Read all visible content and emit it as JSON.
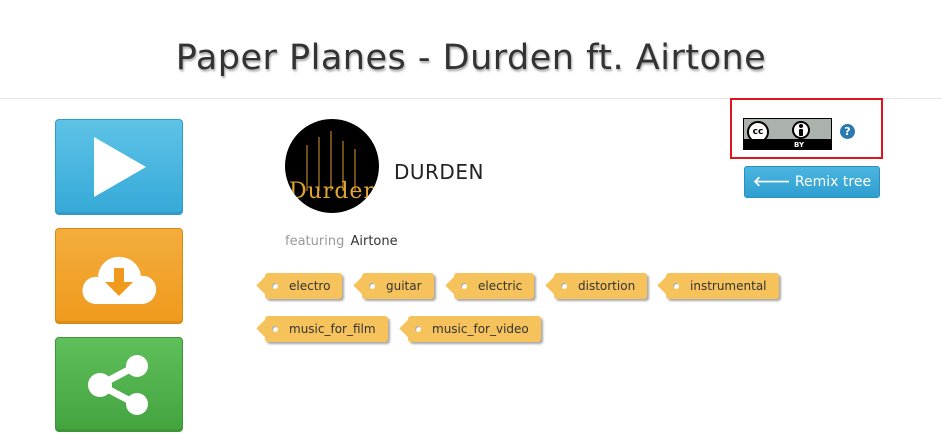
{
  "header": {
    "title": "Paper Planes - Durden ft. Airtone"
  },
  "actions": {
    "play_icon": "play-icon",
    "download_icon": "cloud-download-icon",
    "share_icon": "share-icon",
    "colors": {
      "play": "#3fb3de",
      "download": "#f0a024",
      "share": "#4caf48"
    }
  },
  "artist": {
    "avatar_text": "Durden",
    "name": "DURDEN",
    "featuring_label": "featuring",
    "featuring_name": "Airtone"
  },
  "tags": [
    "electro",
    "guitar",
    "electric",
    "distortion",
    "instrumental",
    "music_for_film",
    "music_for_video"
  ],
  "license": {
    "badge_cc": "cc",
    "badge_by": "BY",
    "help_glyph": "?",
    "highlight_color": "#e0151c"
  },
  "remix": {
    "left_arrow": "🡐",
    "label": "Remix tree",
    "right_arrow": "🡒"
  }
}
